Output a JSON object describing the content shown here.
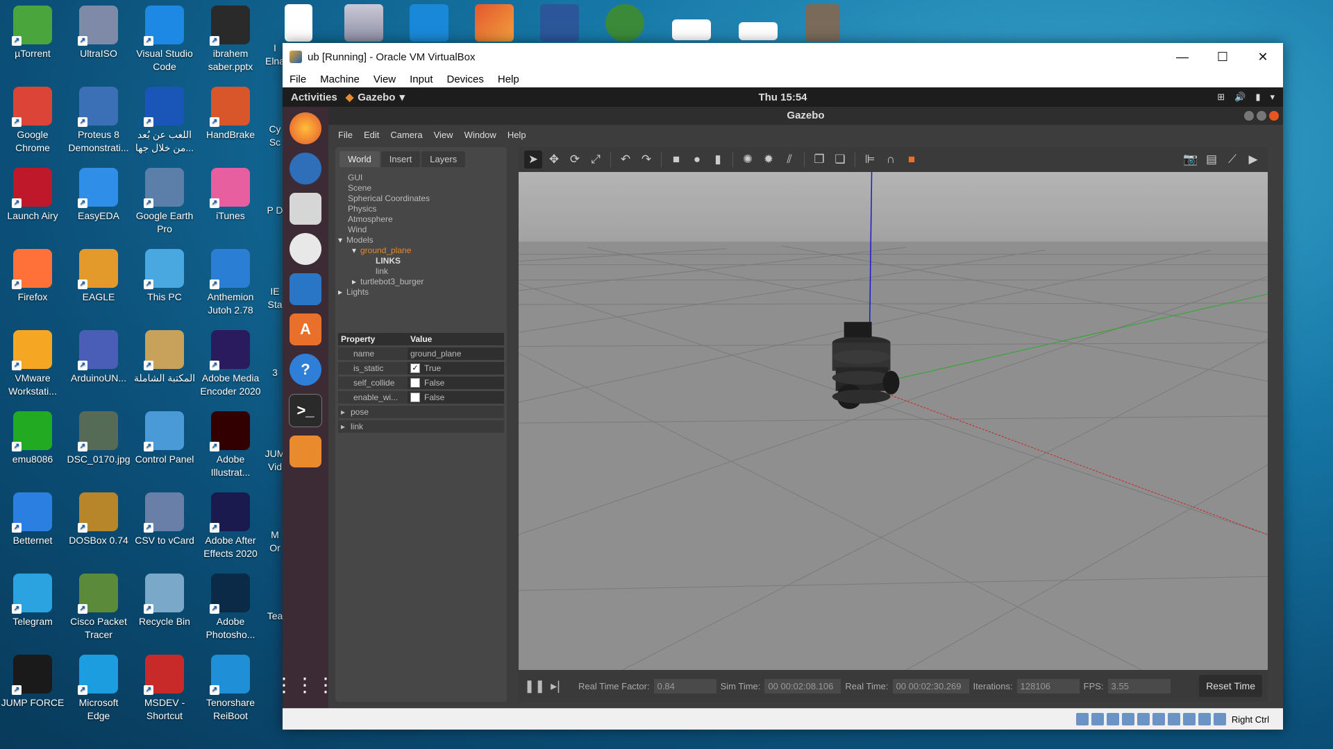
{
  "desktop": {
    "icons": [
      {
        "label": "µTorrent",
        "icon": "utorrent-icon",
        "color": "#4aa53c"
      },
      {
        "label": "UltraISO",
        "icon": "ultraiso-icon",
        "color": "#7f8aa8"
      },
      {
        "label": "Visual Studio Code",
        "icon": "vscode-icon",
        "color": "#1e88e5"
      },
      {
        "label": "ibrahem saber.pptx",
        "icon": "pptx-icon",
        "color": "#2a2a2a"
      },
      {
        "label": "Google Chrome",
        "icon": "chrome-icon",
        "color": "#db4437"
      },
      {
        "label": "Proteus 8 Demonstrati...",
        "icon": "proteus-icon",
        "color": "#3b6fb6"
      },
      {
        "label": "اللعب عن بُعد من خلال جها...",
        "icon": "remote-play-icon",
        "color": "#1a56b8"
      },
      {
        "label": "HandBrake",
        "icon": "handbrake-icon",
        "color": "#d9562b"
      },
      {
        "label": "Launch Airy",
        "icon": "airy-icon",
        "color": "#c0182b"
      },
      {
        "label": "EasyEDA",
        "icon": "easyeda-icon",
        "color": "#2f8fe8"
      },
      {
        "label": "Google Earth Pro",
        "icon": "google-earth-icon",
        "color": "#5b7fa8"
      },
      {
        "label": "iTunes",
        "icon": "itunes-icon",
        "color": "#e85fa0"
      },
      {
        "label": "Firefox",
        "icon": "firefox-icon",
        "color": "#ff7139"
      },
      {
        "label": "EAGLE",
        "icon": "eagle-icon",
        "color": "#e39a2a"
      },
      {
        "label": "This PC",
        "icon": "this-pc-icon",
        "color": "#4aa8e0"
      },
      {
        "label": "Anthemion Jutoh 2.78",
        "icon": "jutoh-icon",
        "color": "#2a7fd4"
      },
      {
        "label": "VMware Workstati...",
        "icon": "vmware-icon",
        "color": "#f5a623"
      },
      {
        "label": "ArduinoUN...",
        "icon": "arduino-as-icon",
        "color": "#4a5eb8"
      },
      {
        "label": "المكتبة الشاملة",
        "icon": "library-icon",
        "color": "#c8a15a"
      },
      {
        "label": "Adobe Media Encoder 2020",
        "icon": "media-encoder-icon",
        "color": "#2a1a5e"
      },
      {
        "label": "emu8086",
        "icon": "emu8086-icon",
        "color": "#22aa22"
      },
      {
        "label": "DSC_0170.jpg",
        "icon": "photo-icon",
        "color": "#556b55"
      },
      {
        "label": "Control Panel",
        "icon": "control-panel-icon",
        "color": "#4a9ad8"
      },
      {
        "label": "Adobe Illustrat...",
        "icon": "illustrator-icon",
        "color": "#330000"
      },
      {
        "label": "Betternet",
        "icon": "betternet-icon",
        "color": "#2a7fe0"
      },
      {
        "label": "DOSBox 0.74",
        "icon": "dosbox-icon",
        "color": "#b8862a"
      },
      {
        "label": "CSV to vCard",
        "icon": "csv-vcard-icon",
        "color": "#6a7fa8"
      },
      {
        "label": "Adobe After Effects 2020",
        "icon": "after-effects-icon",
        "color": "#1a1a4e"
      },
      {
        "label": "Telegram",
        "icon": "telegram-icon",
        "color": "#2aa3e0"
      },
      {
        "label": "Cisco Packet Tracer",
        "icon": "packet-tracer-icon",
        "color": "#5a8a3a"
      },
      {
        "label": "Recycle Bin",
        "icon": "recycle-bin-icon",
        "color": "#7aa8c8"
      },
      {
        "label": "Adobe Photosho...",
        "icon": "photoshop-icon",
        "color": "#0b2a48"
      },
      {
        "label": "JUMP FORCE",
        "icon": "jump-force-icon",
        "color": "#1a1a1a"
      },
      {
        "label": "Microsoft Edge",
        "icon": "edge-icon",
        "color": "#1b9de0"
      },
      {
        "label": "MSDEV - Shortcut",
        "icon": "msdev-icon",
        "color": "#c82a2a"
      },
      {
        "label": "Tenorshare ReiBoot",
        "icon": "reiboot-icon",
        "color": "#1f8fd8"
      }
    ],
    "partial_labels": [
      "I Elna",
      "Cy Sc",
      "P D",
      "IE Sta",
      "3",
      "JUM Vid",
      "M Or",
      "Tea"
    ]
  },
  "vbox": {
    "title": "ub [Running] - Oracle VM VirtualBox",
    "menu": [
      "File",
      "Machine",
      "View",
      "Input",
      "Devices",
      "Help"
    ],
    "status_right": "Right Ctrl"
  },
  "ubuntu": {
    "activities": "Activities",
    "app_menu": "Gazebo",
    "clock": "Thu 15:54"
  },
  "gazebo": {
    "title": "Gazebo",
    "menu": [
      "File",
      "Edit",
      "Camera",
      "View",
      "Window",
      "Help"
    ],
    "tabs": [
      "World",
      "Insert",
      "Layers"
    ],
    "tree": [
      "GUI",
      "Scene",
      "Spherical Coordinates",
      "Physics",
      "Atmosphere",
      "Wind",
      "Models",
      "ground_plane",
      "LINKS",
      "link",
      "turtlebot3_burger",
      "Lights"
    ],
    "props_header": {
      "property": "Property",
      "value": "Value"
    },
    "props": [
      {
        "name": "name",
        "value": "ground_plane",
        "check": null
      },
      {
        "name": "is_static",
        "value": "True",
        "check": true
      },
      {
        "name": "self_collide",
        "value": "False",
        "check": false
      },
      {
        "name": "enable_wi...",
        "value": "False",
        "check": false
      }
    ],
    "expanders": [
      "pose",
      "link"
    ],
    "stats": {
      "rtf_label": "Real Time Factor:",
      "rtf": "0.84",
      "sim_label": "Sim Time:",
      "sim": "00 00:02:08.106",
      "real_label": "Real Time:",
      "real": "00 00:02:30.269",
      "iter_label": "Iterations:",
      "iter": "128106",
      "fps_label": "FPS:",
      "fps": "3.55"
    },
    "reset_time": "Reset Time"
  }
}
